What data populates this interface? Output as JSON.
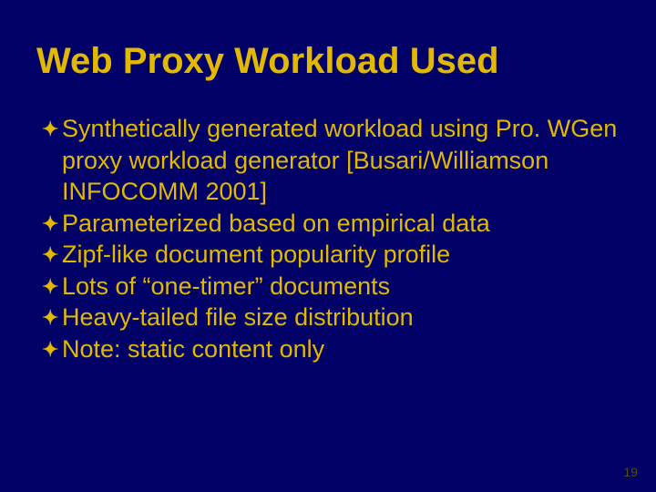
{
  "title": "Web Proxy Workload Used",
  "bullets": [
    "Synthetically generated workload using Pro. WGen proxy workload generator [Busari/Williamson  INFOCOMM 2001]",
    "Parameterized based on empirical data",
    "Zipf-like document popularity profile",
    "Lots of “one-timer” documents",
    "Heavy-tailed file size distribution",
    "Note: static content only"
  ],
  "page_number": "19"
}
